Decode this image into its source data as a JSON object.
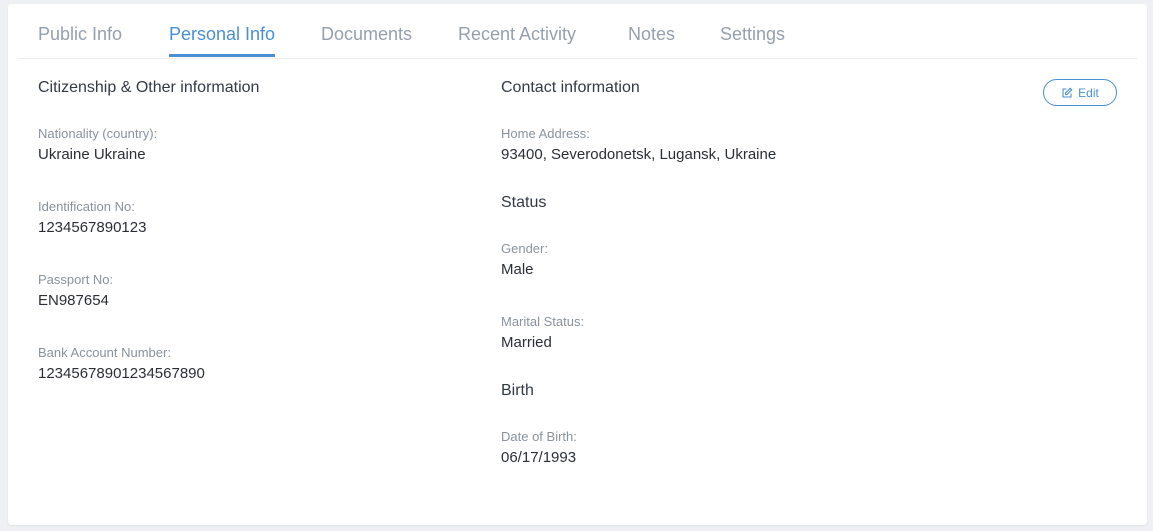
{
  "tabs": [
    {
      "label": "Public Info",
      "active": false
    },
    {
      "label": "Personal Info",
      "active": true
    },
    {
      "label": "Documents",
      "active": false
    },
    {
      "label": "Recent Activity",
      "active": false
    },
    {
      "label": "Notes",
      "active": false
    },
    {
      "label": "Settings",
      "active": false
    }
  ],
  "citizenship": {
    "title": "Citizenship & Other information",
    "nationality_label": "Nationality (country):",
    "nationality_value": "Ukraine Ukraine",
    "identification_label": "Identification No:",
    "identification_value": "1234567890123",
    "passport_label": "Passport No:",
    "passport_value": "EN987654",
    "bank_label": "Bank Account Number:",
    "bank_value": "12345678901234567890"
  },
  "contact": {
    "title": "Contact information",
    "edit_label": "Edit",
    "home_address_label": "Home Address:",
    "home_address_value": "93400, Severodonetsk, Lugansk, Ukraine"
  },
  "status": {
    "title": "Status",
    "gender_label": "Gender:",
    "gender_value": "Male",
    "marital_label": "Marital Status:",
    "marital_value": "Married"
  },
  "birth": {
    "title": "Birth",
    "dob_label": "Date of Birth:",
    "dob_value": "06/17/1993"
  },
  "colors": {
    "accent": "#4a8fd6",
    "tab_inactive": "#96a0ad",
    "label": "#8a929c",
    "value": "#2b2f35"
  },
  "icons": {
    "edit": "edit-icon"
  }
}
